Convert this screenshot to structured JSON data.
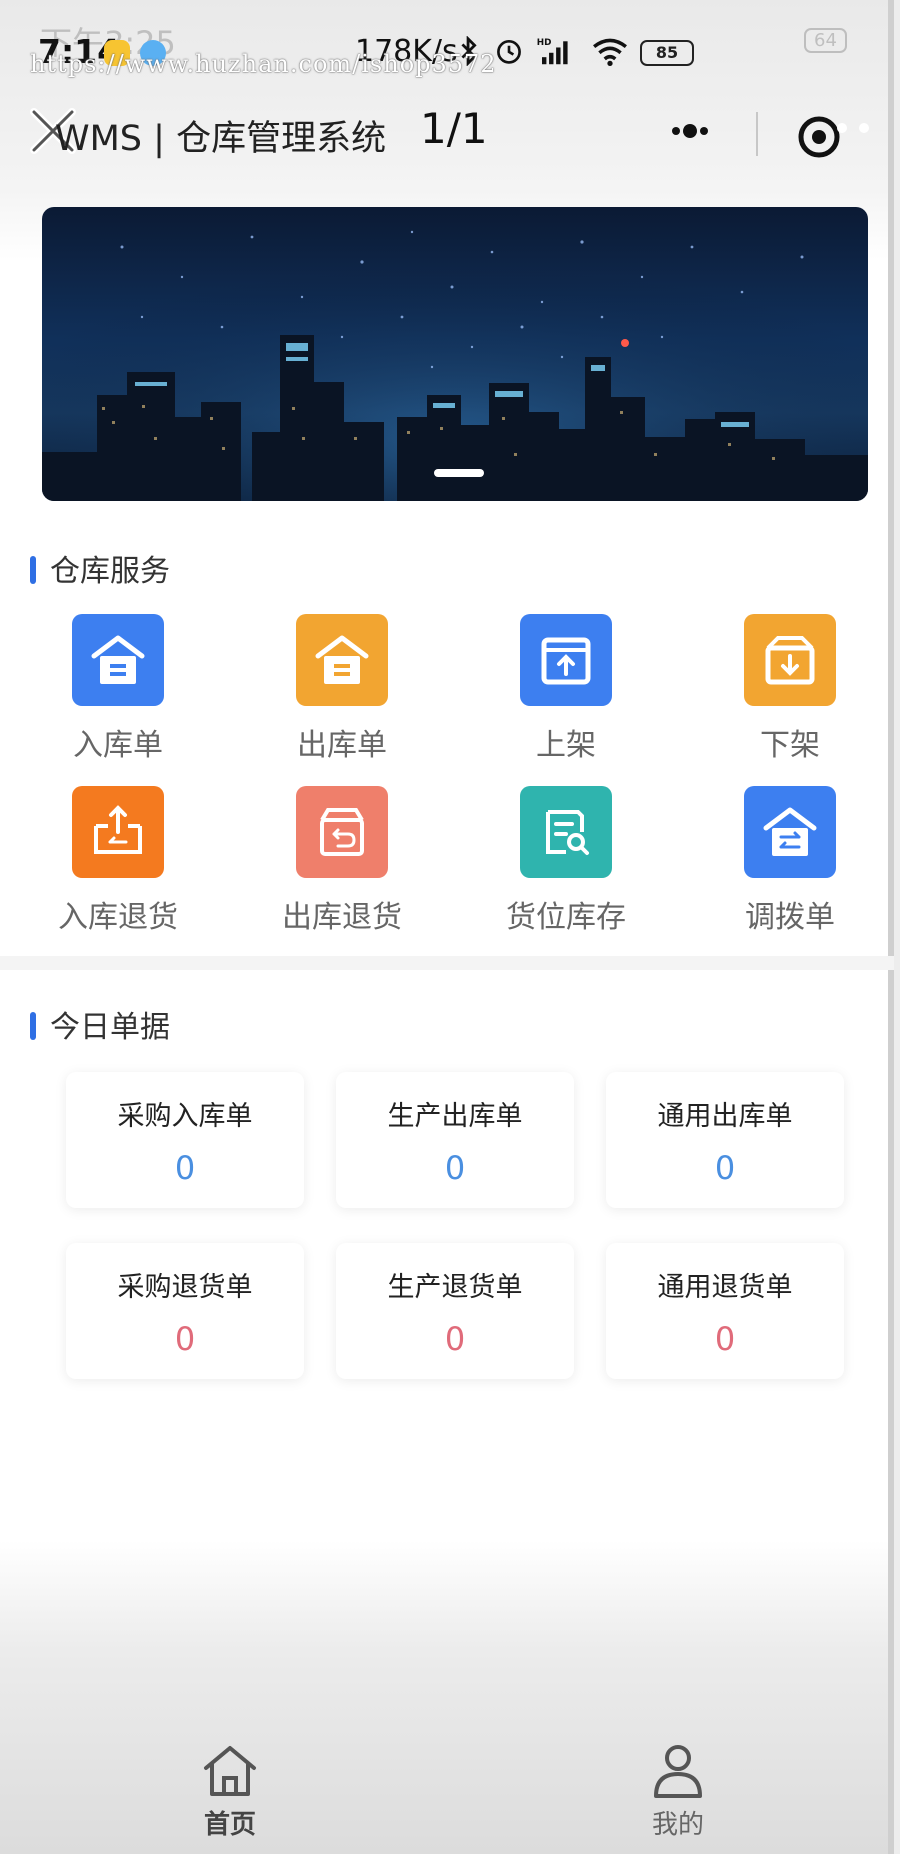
{
  "status_bar": {
    "time": "7:14",
    "ghost_time": "下午3:25",
    "speed": "178K/s",
    "battery": "85",
    "ghost_battery": "64",
    "watermark": "https://www.huzhan.com/ishop3572"
  },
  "nav": {
    "title": "WMS | 仓库管理系统",
    "page_count": "1/1"
  },
  "warehouse_services": {
    "title": "仓库服务",
    "items": [
      {
        "label": "入库单",
        "icon": "warehouse-in-icon",
        "color": "#3d7ff0"
      },
      {
        "label": "出库单",
        "icon": "warehouse-out-icon",
        "color": "#f2a531"
      },
      {
        "label": "上架",
        "icon": "box-up-icon",
        "color": "#3d7ff0"
      },
      {
        "label": "下架",
        "icon": "box-down-icon",
        "color": "#f2a531"
      },
      {
        "label": "入库退货",
        "icon": "return-in-icon",
        "color": "#f47a1f"
      },
      {
        "label": "出库退货",
        "icon": "return-out-icon",
        "color": "#ef7f6b"
      },
      {
        "label": "货位库存",
        "icon": "location-stock-icon",
        "color": "#2fb4ae"
      },
      {
        "label": "调拨单",
        "icon": "transfer-icon",
        "color": "#3d7ff0"
      }
    ]
  },
  "today_documents": {
    "title": "今日单据",
    "cards": [
      {
        "label": "采购入库单",
        "value": "0",
        "color": "#4a8fe0"
      },
      {
        "label": "生产出库单",
        "value": "0",
        "color": "#4a8fe0"
      },
      {
        "label": "通用出库单",
        "value": "0",
        "color": "#4a8fe0"
      },
      {
        "label": "采购退货单",
        "value": "0",
        "color": "#e06b7a"
      },
      {
        "label": "生产退货单",
        "value": "0",
        "color": "#e06b7a"
      },
      {
        "label": "通用退货单",
        "value": "0",
        "color": "#e06b7a"
      }
    ]
  },
  "tab_bar": {
    "items": [
      {
        "label": "首页",
        "icon": "home-icon",
        "active": true
      },
      {
        "label": "我的",
        "icon": "user-icon",
        "active": false
      }
    ]
  }
}
